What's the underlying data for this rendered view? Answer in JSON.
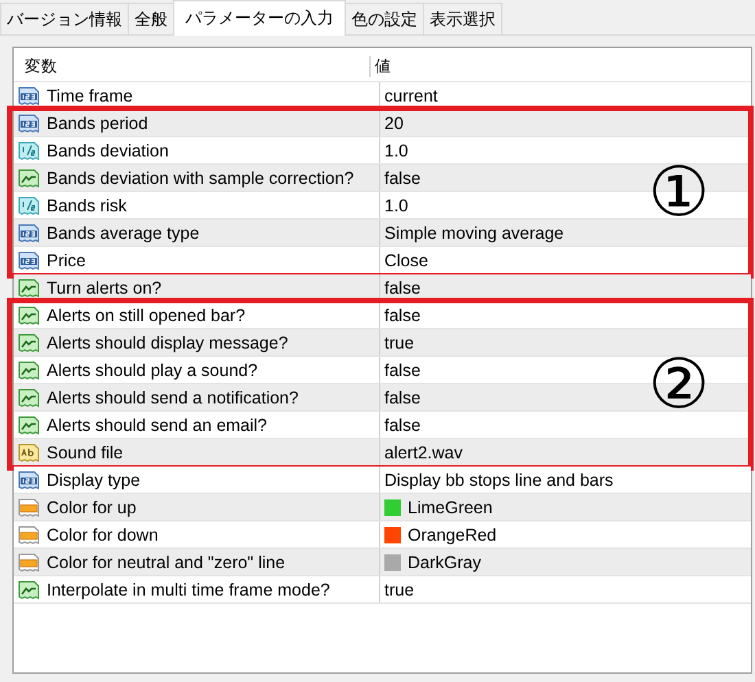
{
  "tabs": [
    {
      "label": "バージョン情報",
      "selected": false
    },
    {
      "label": "全般",
      "selected": false
    },
    {
      "label": "パラメーターの入力",
      "selected": true
    },
    {
      "label": "色の設定",
      "selected": false
    },
    {
      "label": "表示選択",
      "selected": false
    }
  ],
  "table": {
    "columns": [
      "変数",
      "値"
    ],
    "row_groups": [
      {
        "rows": [
          {
            "kind": "int",
            "name": "Time frame",
            "value": "current"
          }
        ]
      },
      {
        "callout": "①",
        "rows": [
          {
            "kind": "int",
            "name": "Bands period",
            "value": "20"
          },
          {
            "kind": "double",
            "name": "Bands deviation",
            "value": "1.0"
          },
          {
            "kind": "bool",
            "name": "Bands deviation with sample correction?",
            "value": "false"
          },
          {
            "kind": "double",
            "name": "Bands risk",
            "value": "1.0"
          },
          {
            "kind": "int",
            "name": "Bands average type",
            "value": "Simple moving average"
          },
          {
            "kind": "int",
            "name": "Price",
            "value": "Close"
          }
        ]
      },
      {
        "rows": [
          {
            "kind": "bool",
            "name": "Turn alerts on?",
            "value": "false"
          }
        ]
      },
      {
        "callout": "②",
        "rows": [
          {
            "kind": "bool",
            "name": "Alerts on still opened bar?",
            "value": "false"
          },
          {
            "kind": "bool",
            "name": "Alerts should display message?",
            "value": "true"
          },
          {
            "kind": "bool",
            "name": "Alerts should play a sound?",
            "value": "false"
          },
          {
            "kind": "bool",
            "name": "Alerts should send a notification?",
            "value": "false"
          },
          {
            "kind": "bool",
            "name": "Alerts should send an email?",
            "value": "false"
          },
          {
            "kind": "string",
            "name": "Sound file",
            "value": "alert2.wav"
          }
        ]
      },
      {
        "rows": [
          {
            "kind": "int",
            "name": "Display type",
            "value": "Display bb stops line and bars"
          },
          {
            "kind": "color",
            "name": "Color for up",
            "value": "LimeGreen",
            "color": "#32cd32"
          },
          {
            "kind": "color",
            "name": "Color for down",
            "value": "OrangeRed",
            "color": "#ff4500"
          },
          {
            "kind": "color",
            "name": "Color for neutral and \"zero\" line",
            "value": "DarkGray",
            "color": "#a9a9a9"
          },
          {
            "kind": "bool",
            "name": "Interpolate in multi time frame mode?",
            "value": "true"
          }
        ]
      }
    ]
  }
}
